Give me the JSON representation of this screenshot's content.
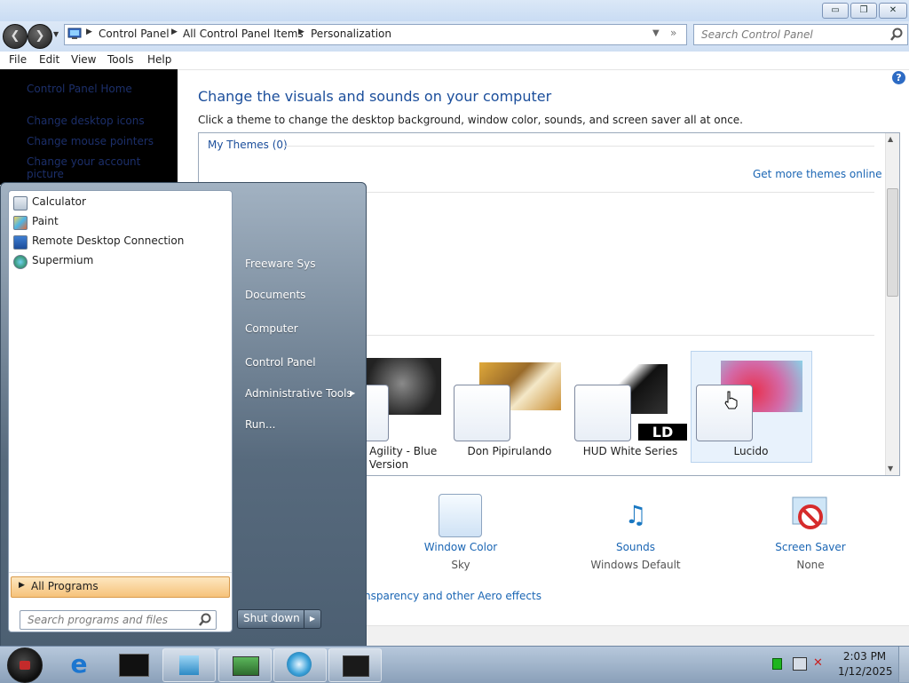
{
  "window": {
    "minimize": "▭",
    "restore": "❐",
    "close": "✕"
  },
  "address": {
    "crumbs": [
      "Control Panel",
      "All Control Panel Items",
      "Personalization"
    ],
    "search_placeholder": "Search Control Panel"
  },
  "menu": [
    "File",
    "Edit",
    "View",
    "Tools",
    "Help"
  ],
  "leftnav": {
    "home": "Control Panel Home",
    "links": [
      "Change desktop icons",
      "Change mouse pointers",
      "Change your account picture"
    ]
  },
  "main": {
    "heading": "Change the visuals and sounds on your computer",
    "subtitle": "Click a theme to change the desktop background, window color, sounds, and screen saver all at once.",
    "my_themes": "My Themes (0)",
    "get_more": "Get more themes online",
    "themes": [
      {
        "name_line1": "c Agility - Blue",
        "name_line2": "Version"
      },
      {
        "name_line1": "Don Pipirulando",
        "name_line2": ""
      },
      {
        "name_line1": "HUD White Series",
        "name_line2": ""
      },
      {
        "name_line1": "Lucido",
        "name_line2": ""
      }
    ],
    "hud_logo": "LD"
  },
  "settings": [
    {
      "label": "Window Color",
      "value": "Sky"
    },
    {
      "label": "Sounds",
      "value": "Windows Default"
    },
    {
      "label": "Screen Saver",
      "value": "None"
    }
  ],
  "aero_link": "nsparency and other Aero effects",
  "startmenu": {
    "programs": [
      "Calculator",
      "Paint",
      "Remote Desktop Connection",
      "Supermium"
    ],
    "all_programs": "All Programs",
    "search_placeholder": "Search programs and files",
    "right": [
      "Freeware Sys",
      "Documents",
      "Computer",
      "Control Panel",
      "Administrative Tools",
      "Run..."
    ],
    "shutdown": "Shut down"
  },
  "tray": {
    "time": "2:03 PM",
    "date": "1/12/2025"
  },
  "colors": {
    "accent": "#1b4e9b",
    "link": "#1b66b4"
  }
}
